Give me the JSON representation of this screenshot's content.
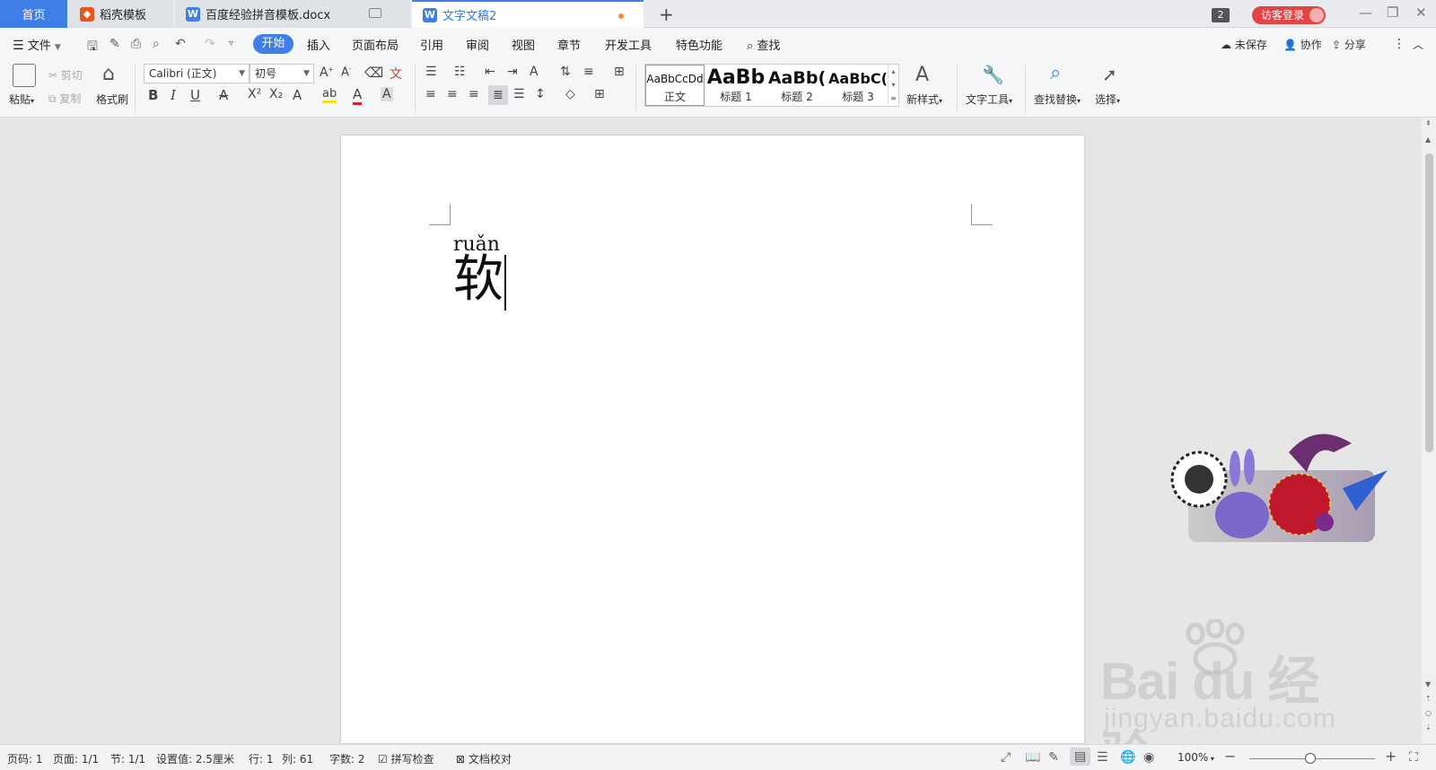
{
  "tabs": {
    "home": "首页",
    "template": "稻壳模板",
    "doc1": "百度经验拼音模板.docx",
    "doc2": "文字文稿2",
    "add": "+"
  },
  "window": {
    "badge": "2",
    "login": "访客登录",
    "minimize": "—",
    "restore": "❐",
    "close": "✕"
  },
  "menu": {
    "file": "文件",
    "items": [
      "开始",
      "插入",
      "页面布局",
      "引用",
      "审阅",
      "视图",
      "章节",
      "开发工具",
      "特色功能"
    ],
    "search": "查找",
    "unsaved": "未保存",
    "collab": "协作",
    "share": "分享"
  },
  "ribbon": {
    "paste": "粘贴",
    "cut": "剪切",
    "copy": "复制",
    "format_painter": "格式刷",
    "font_name": "Calibri (正文)",
    "font_size": "初号",
    "styles": [
      {
        "sample": "AaBbCcDd",
        "name": "正文"
      },
      {
        "sample": "AaBb",
        "name": "标题 1"
      },
      {
        "sample": "AaBb(",
        "name": "标题 2"
      },
      {
        "sample": "AaBbC(",
        "name": "标题 3"
      }
    ],
    "new_style": "新样式",
    "text_tools": "文字工具",
    "find_replace": "查找替换",
    "select": "选择"
  },
  "document": {
    "pinyin": "ruǎn",
    "hanzi": "软"
  },
  "watermark": {
    "main": "Bai du 经验",
    "sub": "jingyan.baidu.com"
  },
  "status": {
    "page": "页码: 1",
    "pages": "页面: 1/1",
    "section": "节: 1/1",
    "setting": "设置值: 2.5厘米",
    "row": "行: 1",
    "col": "列: 61",
    "words": "字数: 2",
    "spell": "拼写检查",
    "proof": "文档校对",
    "zoom": "100%"
  },
  "colors": {
    "accent": "#3e7ee6",
    "login": "#e24444",
    "unsaved_dot": "#f08c3a"
  }
}
